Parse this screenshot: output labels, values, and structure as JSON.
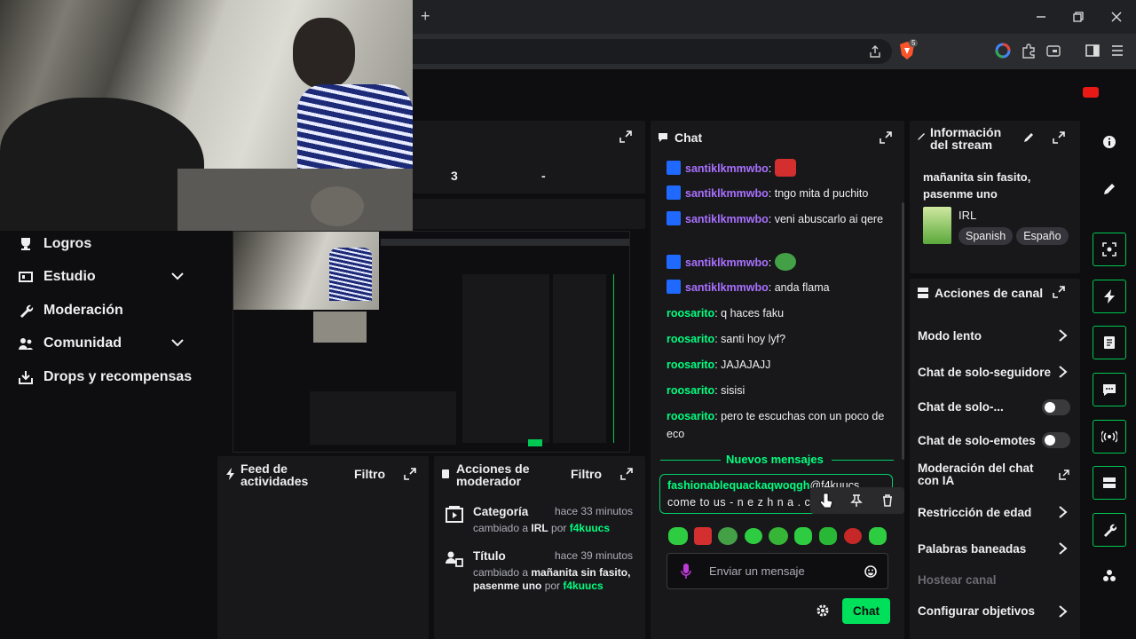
{
  "browser": {
    "new_tab": "+",
    "brave_badge": "5"
  },
  "nav": {
    "items": [
      {
        "label": "Logros"
      },
      {
        "label": "Estudio"
      },
      {
        "label": "Moderación"
      },
      {
        "label": "Comunidad"
      },
      {
        "label": "Drops y recompensas"
      }
    ]
  },
  "stats": {
    "value_a": "3",
    "value_b": "-"
  },
  "chat": {
    "title": "Chat",
    "messages": [
      {
        "user": "santiklkmmwbo",
        "text": ""
      },
      {
        "user": "santiklkmmwbo",
        "text": "tngo mita d puchito"
      },
      {
        "user": "santiklkmmwbo",
        "text": "veni abuscarlo ai qere"
      },
      {
        "user": "santiklkmmwbo",
        "text": ""
      },
      {
        "user": "santiklkmmwbo",
        "text": "anda flama"
      },
      {
        "user": "roosarito",
        "text": "q haces faku"
      },
      {
        "user": "roosarito",
        "text": "santi hoy lyf?"
      },
      {
        "user": "roosarito",
        "text": "JAJAJAJJ"
      },
      {
        "user": "roosarito",
        "text": "sisisi"
      },
      {
        "user": "roosarito",
        "text": "pero te escuchas con un poco de eco"
      }
    ],
    "new_messages": "Nuevos mensajes",
    "highlight": {
      "user": "fashionablequackaqwoqgh",
      "mention": "@f4kuucs",
      "text": "come to us - n e z h n a . c o"
    },
    "input_placeholder": "Enviar un mensaje",
    "send_label": "Chat"
  },
  "stream_info": {
    "title": "Información del stream",
    "stream_title": "mañanita sin fasito, pasenme uno",
    "category": "IRL",
    "tags": [
      "Spanish",
      "Españo"
    ]
  },
  "channel_actions": {
    "title": "Acciones de canal",
    "items": [
      {
        "label": "Modo lento"
      },
      {
        "label": "Chat de solo-seguidore"
      },
      {
        "label": "Chat de solo-..."
      },
      {
        "label": "Chat de solo-emotes"
      },
      {
        "label": "Moderación del chat con IA"
      },
      {
        "label": "Restricción de edad"
      },
      {
        "label": "Palabras baneadas"
      },
      {
        "label": "Hostear canal"
      },
      {
        "label": "Configurar objetivos"
      }
    ]
  },
  "activity_feed": {
    "title": "Feed de actividades",
    "filter": "Filtro"
  },
  "mod_actions": {
    "title": "Acciones de moderador",
    "filter": "Filtro",
    "entries": [
      {
        "title": "Categoría",
        "time": "hace 33 minutos",
        "prefix": "cambiado a ",
        "value": "IRL",
        "by": " por ",
        "user": "f4kuucs"
      },
      {
        "title": "Título",
        "time": "hace 39 minutos",
        "prefix": "cambiado a ",
        "value": "mañanita sin fasito, pasenme uno",
        "by": " por ",
        "user": "f4kuucs"
      }
    ]
  },
  "colors": {
    "purple": "#a970ff",
    "green": "#00ff7f",
    "accent_green": "#00d166",
    "bg": "#0e0e10",
    "panel": "#18181b"
  }
}
